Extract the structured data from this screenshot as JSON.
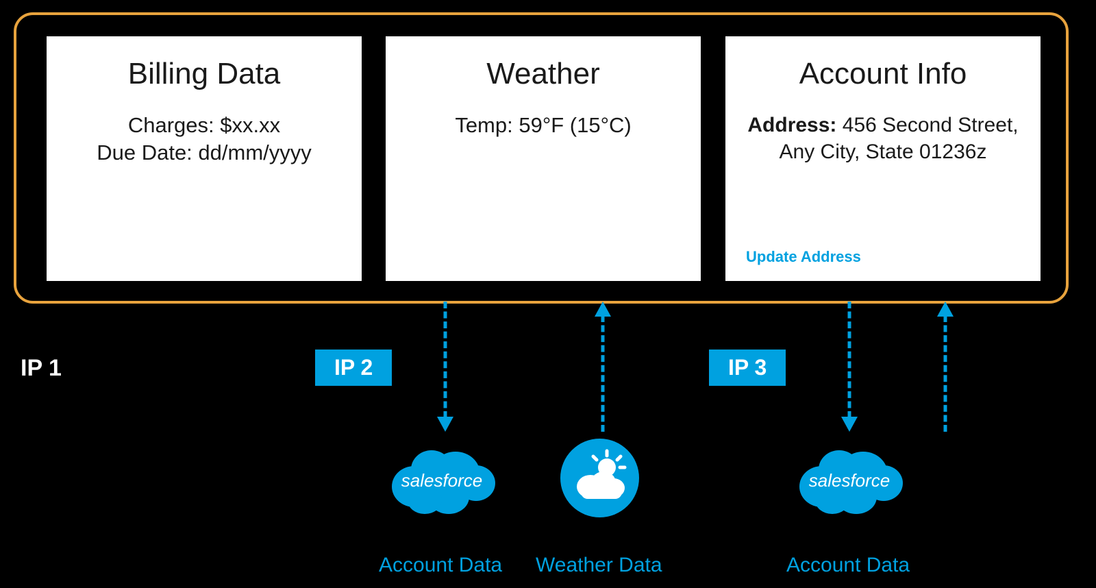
{
  "diagram": {
    "labels": {
      "ip1": "IP 1",
      "ip2": "IP 2",
      "ip3": "IP 3"
    },
    "cards": {
      "billing": {
        "title": "Billing Data",
        "line1": "Charges: $xx.xx",
        "line2": "Due Date: dd/mm/yyyy"
      },
      "weather": {
        "title": "Weather",
        "temp": "Temp: 59°F (15°C)"
      },
      "account": {
        "title": "Account Info",
        "address_label": "Address:",
        "address_value": "456 Second Street, Any City, State 01236z",
        "update_link": "Update Address"
      }
    },
    "sources": {
      "account_data_1": "Account Data",
      "weather_data": "Weather Data",
      "account_data_2": "Account Data"
    },
    "icons": {
      "salesforce_text": "salesforce"
    },
    "colors": {
      "accent": "#00a1e0",
      "frame": "#e8a33d"
    }
  }
}
